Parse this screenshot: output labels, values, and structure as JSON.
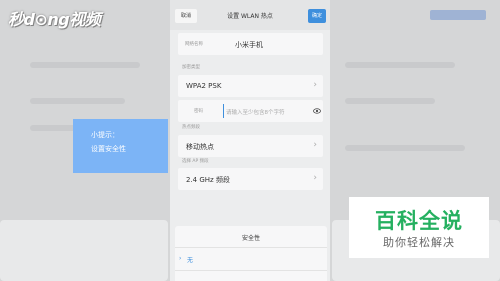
{
  "watermark_top": "秒d⊙ng视频",
  "watermark_bottom": {
    "big": "百科全说",
    "small": "助你轻松解决"
  },
  "dialog": {
    "title": "设置 WLAN 热点",
    "cancel_label": "取消",
    "ok_label": "确定",
    "name_label": "网络名称",
    "name_value": "小米手机",
    "security_label": "加密类型",
    "security_value": "WPA2 PSK",
    "password_label": "密码",
    "password_placeholder": "请输入至少包含8个字符",
    "band_section_label": "热点频段",
    "band_value": "移动热点",
    "ap_band_label": "选择 AP 频段",
    "ap_band_value": "2.4 GHz 频段"
  },
  "hint": {
    "line1": "小提示：",
    "line2": "设置安全性"
  },
  "security_sheet": {
    "title": "安全性",
    "option": "无"
  },
  "colors": {
    "accent": "#3e8fdd",
    "hint_bg": "#7cb4f6",
    "brand_green": "#25b060"
  }
}
